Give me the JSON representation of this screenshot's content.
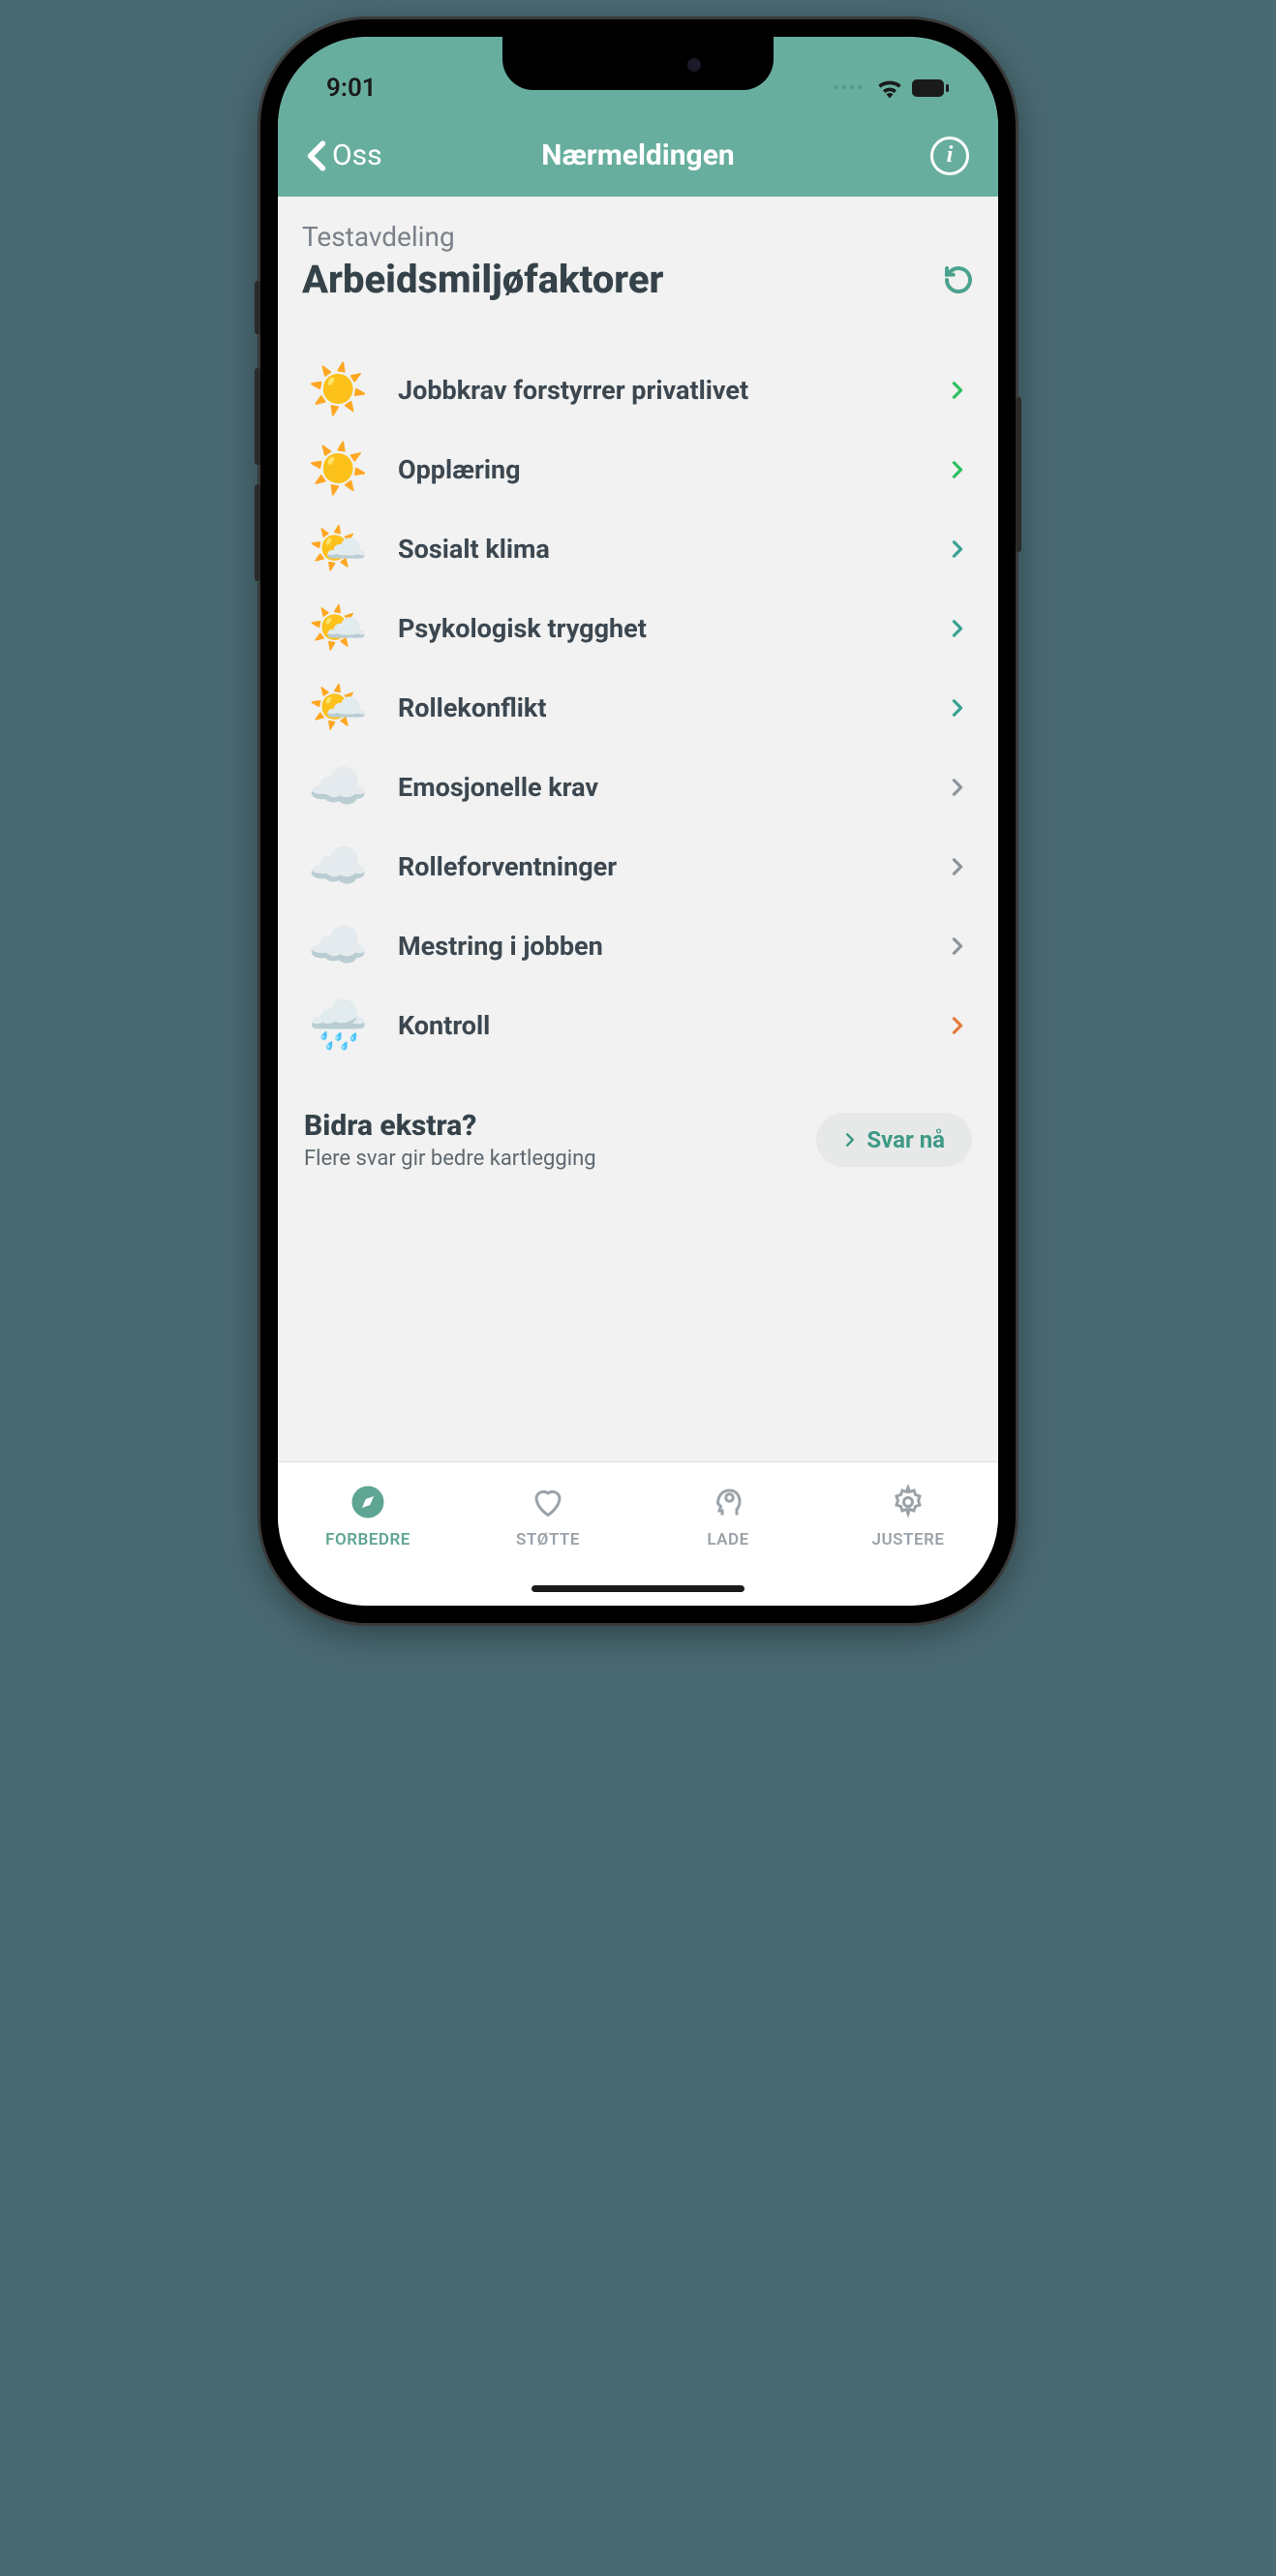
{
  "status": {
    "time": "9:01"
  },
  "header": {
    "back_label": "Oss",
    "title": "Nærmeldingen"
  },
  "page": {
    "subtitle": "Testavdeling",
    "title": "Arbeidsmiljøfaktorer"
  },
  "factors": [
    {
      "icon": "sun",
      "label": "Jobbkrav forstyrrer privatlivet",
      "chev": "green"
    },
    {
      "icon": "sun",
      "label": "Opplæring",
      "chev": "green"
    },
    {
      "icon": "partly",
      "label": "Sosialt klima",
      "chev": "teal"
    },
    {
      "icon": "partly",
      "label": "Psykologisk trygghet",
      "chev": "teal"
    },
    {
      "icon": "partly",
      "label": "Rollekonflikt",
      "chev": "teal"
    },
    {
      "icon": "cloud",
      "label": "Emosjonelle krav",
      "chev": "gray"
    },
    {
      "icon": "cloud",
      "label": "Rolleforventninger",
      "chev": "gray"
    },
    {
      "icon": "cloud",
      "label": "Mestring i jobben",
      "chev": "gray"
    },
    {
      "icon": "rain",
      "label": "Kontroll",
      "chev": "orange"
    }
  ],
  "extra": {
    "title": "Bidra ekstra?",
    "subtitle": "Flere svar gir bedre kartlegging",
    "button": "Svar nå"
  },
  "tabs": [
    {
      "label": "FORBEDRE",
      "icon": "compass",
      "active": true
    },
    {
      "label": "STØTTE",
      "icon": "heart",
      "active": false
    },
    {
      "label": "LADE",
      "icon": "head",
      "active": false
    },
    {
      "label": "JUSTERE",
      "icon": "gear",
      "active": false
    }
  ],
  "icon_map": {
    "sun": "☀️",
    "partly": "🌤️",
    "cloud": "☁️",
    "rain": "🌧️"
  }
}
